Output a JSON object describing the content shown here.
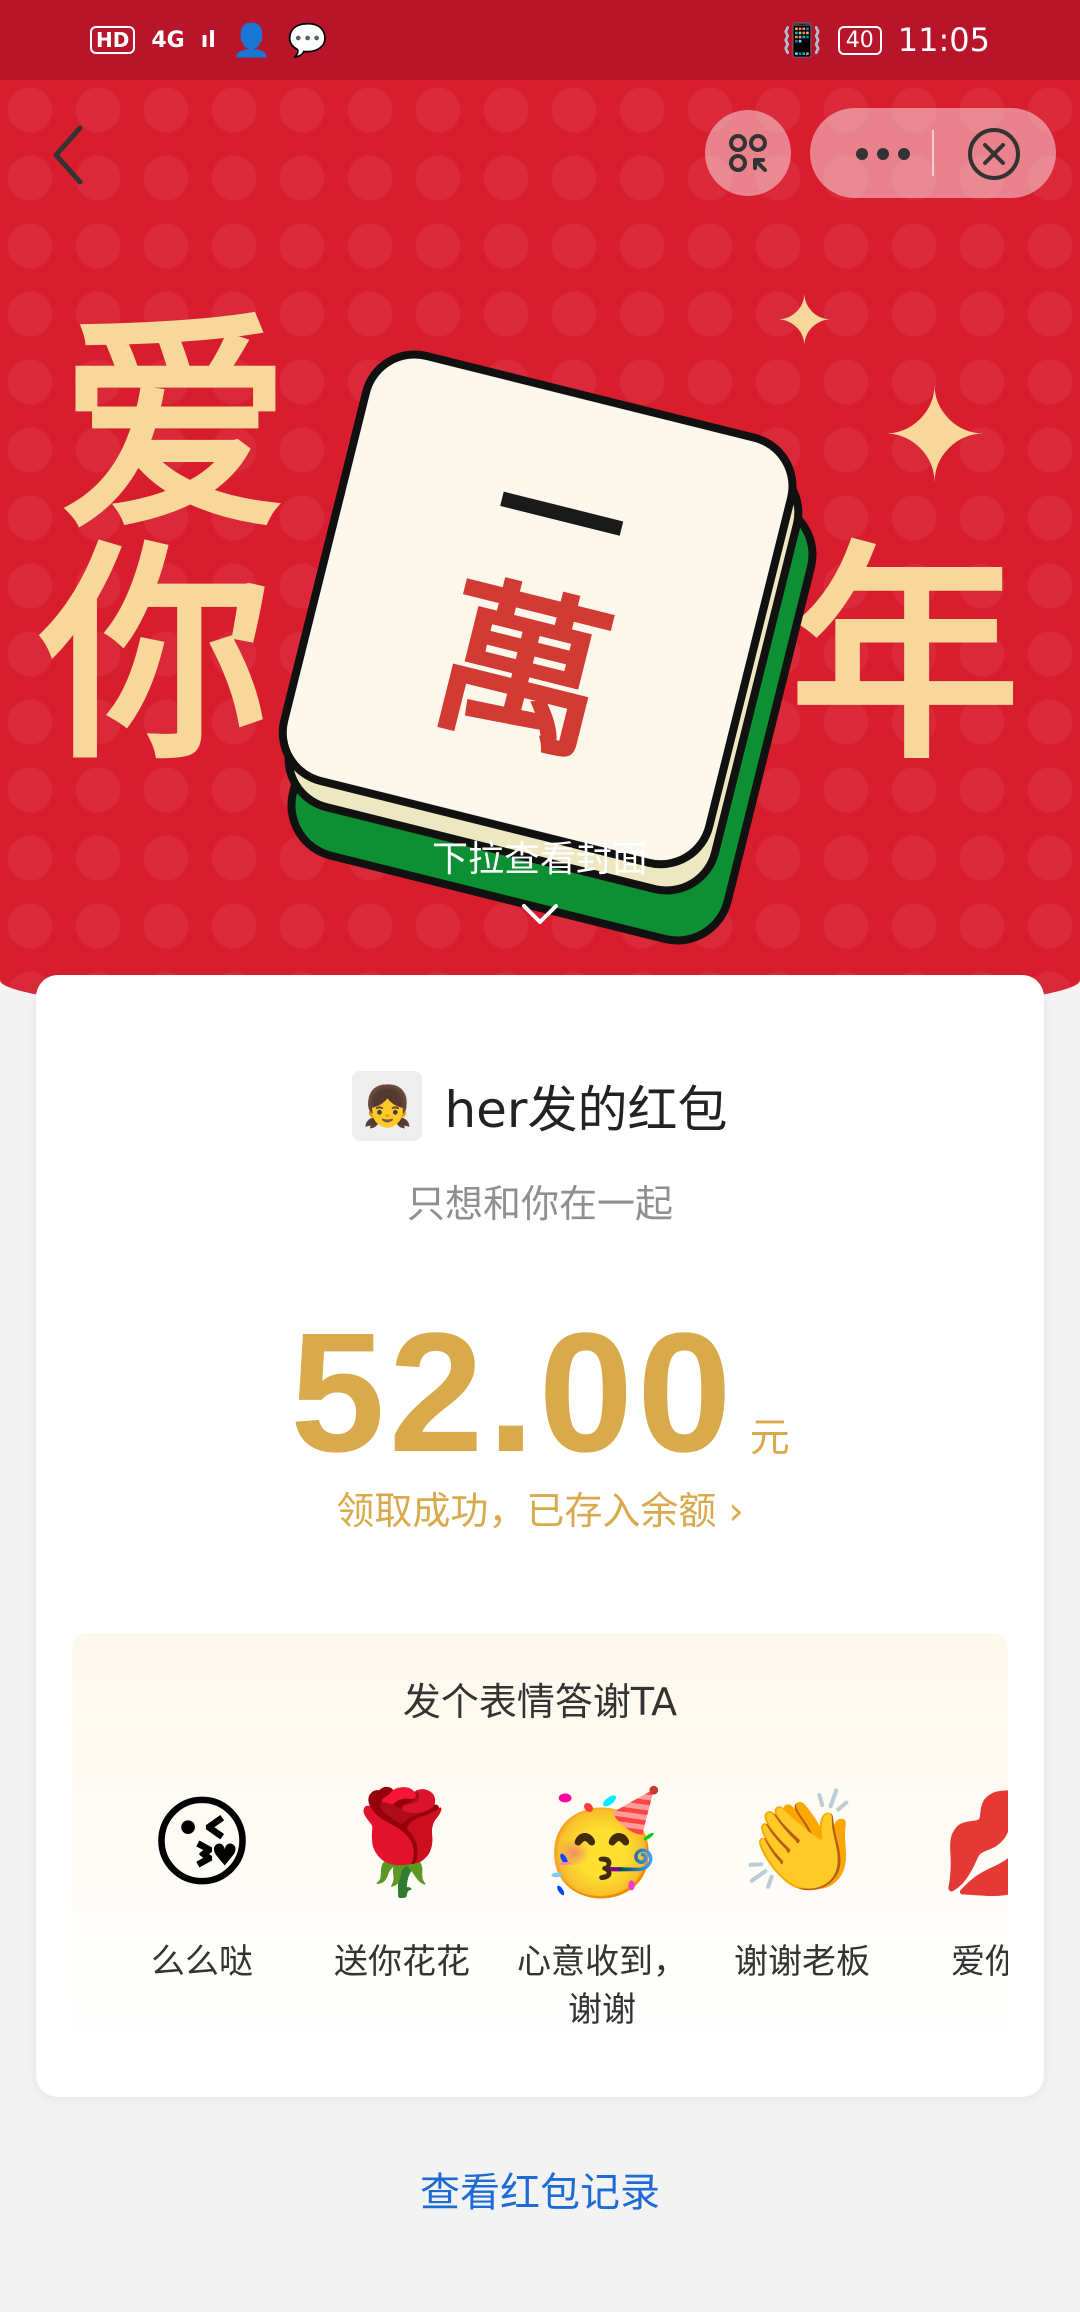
{
  "status_bar": {
    "hd": "HD",
    "network": "4G",
    "signal": "ıl",
    "battery": "40",
    "time": "11:05"
  },
  "cover": {
    "chars": [
      "爱",
      "你",
      "年"
    ],
    "tile_top": "一",
    "tile_bottom": "萬",
    "pull_hint": "下拉查看封面"
  },
  "packet": {
    "sender_title": "her发的红包",
    "blessing": "只想和你在一起",
    "amount": "52.00",
    "unit": "元",
    "status": "领取成功，已存入余额 ›"
  },
  "thanks": {
    "title": "发个表情答谢TA",
    "stickers": [
      {
        "emoji": "😘",
        "label": "么么哒"
      },
      {
        "emoji": "🌹",
        "label": "送你花花"
      },
      {
        "emoji": "🥳",
        "label": "心意收到，谢谢"
      },
      {
        "emoji": "👏",
        "label": "谢谢老板"
      },
      {
        "emoji": "💋",
        "label": "爱你么"
      }
    ]
  },
  "footer": {
    "records_link": "查看红包记录"
  },
  "colors": {
    "cover_red": "#d81d2e",
    "gold": "#d9aa4c",
    "link_blue": "#1e6bd6"
  }
}
